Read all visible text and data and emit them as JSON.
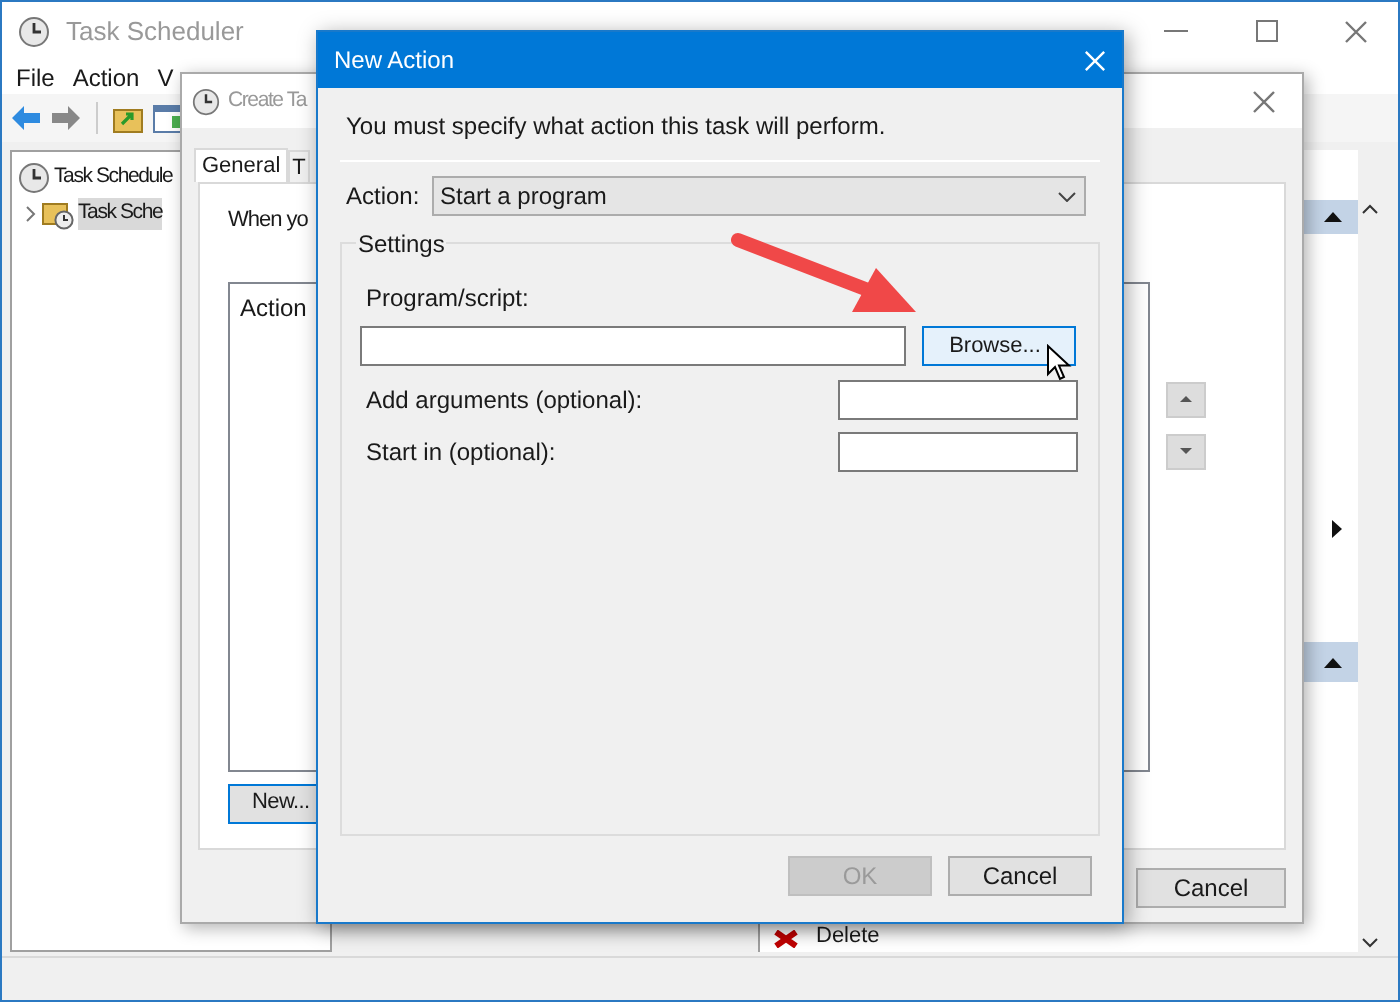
{
  "main_window": {
    "title": "Task Scheduler",
    "menu": [
      "File",
      "Action",
      "V"
    ],
    "tree": [
      {
        "label": "Task Schedule",
        "selected": false,
        "children": [
          {
            "label": "Task Sche",
            "selected": true,
            "expanded": false
          }
        ]
      }
    ],
    "actions_pane": {
      "items": [
        {
          "label": "Delete"
        }
      ]
    }
  },
  "create_task_dialog": {
    "title": "Create Ta",
    "tabs": [
      {
        "label": "General",
        "selected": true
      },
      {
        "label": "T",
        "selected": false
      }
    ],
    "description": "When yo",
    "actions_table": {
      "columns": [
        "Action"
      ]
    },
    "new_button": "New...",
    "cancel_button": "Cancel"
  },
  "new_action_dialog": {
    "title": "New Action",
    "instruction": "You must specify what action this task will perform.",
    "action": {
      "label": "Action:",
      "value": "Start a program"
    },
    "settings": {
      "legend": "Settings",
      "program": {
        "label": "Program/script:",
        "browse": {
          "label": "Browse...",
          "hovered": true
        }
      },
      "arguments": {
        "label": "Add arguments (optional):"
      },
      "start_in": {
        "label": "Start in (optional):"
      }
    },
    "buttons": [
      {
        "label": "OK",
        "disabled": true
      },
      {
        "label": "Cancel",
        "disabled": false
      }
    ]
  }
}
